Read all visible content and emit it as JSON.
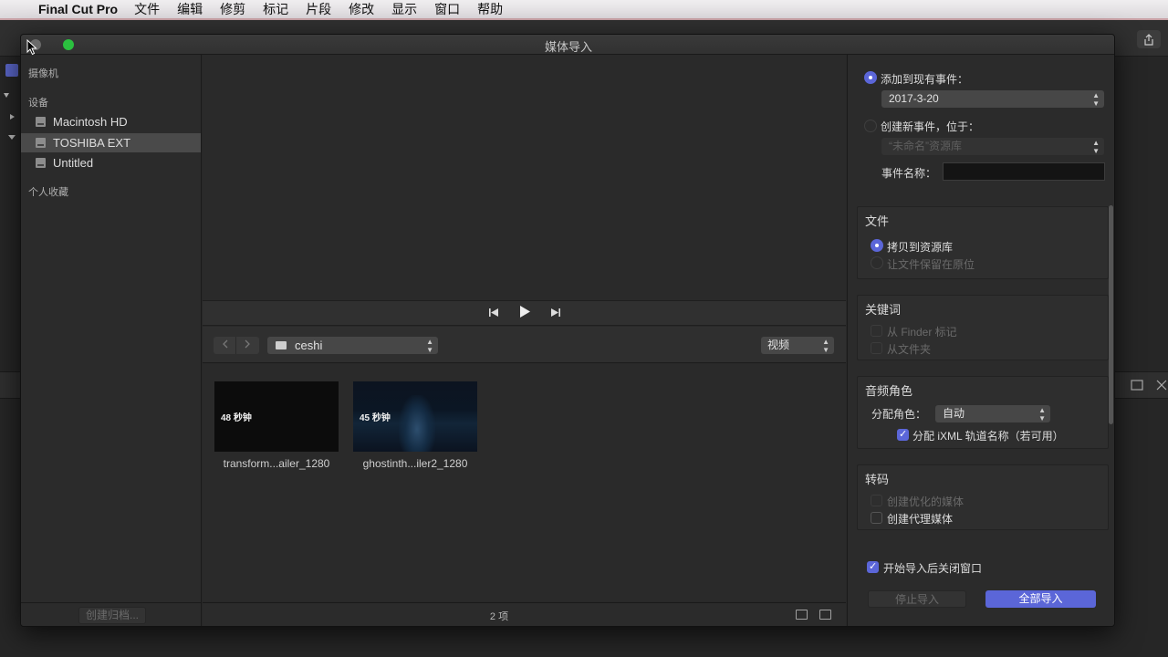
{
  "menubar": {
    "app_name": "Final Cut Pro",
    "items": [
      "文件",
      "编辑",
      "修剪",
      "标记",
      "片段",
      "修改",
      "显示",
      "窗口",
      "帮助"
    ]
  },
  "window": {
    "title": "媒体导入"
  },
  "sidebar": {
    "section_camera": "摄像机",
    "section_devices": "设备",
    "devices": [
      "Macintosh HD",
      "TOSHIBA EXT",
      "Untitled"
    ],
    "selected_device": "TOSHIBA EXT",
    "section_favorites": "个人收藏",
    "create_archive_label": "创建归档..."
  },
  "browser": {
    "folder": "ceshi",
    "filter": "视频",
    "clips": [
      {
        "duration": "48 秒钟",
        "name": "transform...ailer_1280"
      },
      {
        "duration": "45 秒钟",
        "name": "ghostinth...iler2_1280"
      }
    ],
    "item_count": "2 项"
  },
  "options": {
    "add_to_existing_event_label": "添加到现有事件：",
    "existing_event_value": "2017-3-20",
    "create_new_event_label": "创建新事件，位于：",
    "new_event_library_value": "“未命名”资源库",
    "event_name_label": "事件名称：",
    "event_name_value": "",
    "files_section": "文件",
    "copy_to_library_label": "拷贝到资源库",
    "leave_in_place_label": "让文件保留在原位",
    "keywords_section": "关键词",
    "from_finder_tags_label": "从 Finder 标记",
    "from_folders_label": "从文件夹",
    "audio_roles_section": "音频角色",
    "assign_role_label": "分配角色：",
    "assign_role_value": "自动",
    "assign_ixml_label": "分配 iXML 轨道名称（若可用）",
    "transcode_section": "转码",
    "create_optimized_label": "创建优化的媒体",
    "create_proxy_label": "创建代理媒体",
    "close_after_import_label": "开始导入后关闭窗口",
    "stop_import_label": "停止导入",
    "import_all_label": "全部导入"
  },
  "colors": {
    "accent": "#5b66d8"
  }
}
